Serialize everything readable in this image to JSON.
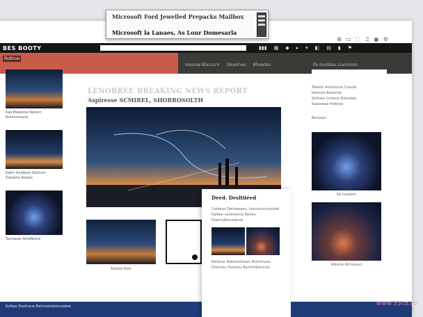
{
  "float_card": {
    "line1": "Microsoft Ford Jewelled Prepacks Mailbox",
    "line2": "Microsoft la Lanaes, As Lour Domesarla"
  },
  "toolbar": {
    "icons": [
      "⊞",
      "▭",
      "⬚",
      "♫",
      "▣",
      "⚙"
    ]
  },
  "navbar": {
    "brand": "BES BOOTY",
    "icons": [
      "▮▮▮",
      "▦",
      "◆",
      "▸",
      "▾",
      "◧",
      "▤",
      "▮",
      "⚑"
    ]
  },
  "subbar": {
    "tag": "Ruttrun",
    "links": [
      "Hasrow Blacca Ir",
      "DeaHnee",
      "Bhowtes"
    ],
    "right": "Pe Kumbau Liarimnm"
  },
  "left_cards": [
    {
      "caption": "Kae Blakeme Nelaon\nRrommmune"
    },
    {
      "caption": "Kabrr Anelkion Kesllum\nDanalne Kelaon"
    },
    {
      "caption": "Samaoas AmeNoine"
    }
  ],
  "main": {
    "headline": "LENOBREE BREAKING NEWS REPORT",
    "subhead": "Aspiresse SCMIREL, SHORROSOLTH"
  },
  "thumbs": [
    {
      "caption": "Kelatio Kele"
    },
    {
      "caption": ""
    }
  ],
  "overlay": {
    "title": "Deed. Desltiiéed",
    "body1": "Cerbeus Delineeaeu, Ineuneutrvumbat Kalbeo vantrheme Paoles Diamiuibonadenal",
    "body2": "Kenbiue Bakoavilinaes Kelsmnuou Doetneu Hosmeu Banchhbonnvis"
  },
  "right": {
    "note": "Taketle Ahesianne Ceaule\nKelwure Beolonle\nSelitare Corlaun Deoralee\nKaasneaa Holbtae",
    "label": "Bertaiyn",
    "cards": [
      {
        "caption": "Ka lualaem"
      },
      {
        "caption": "Alkalne Atmreaun"
      }
    ]
  },
  "footer": {
    "links": "Kolbao Doolnaue Balroneslalenuadwe"
  },
  "watermark": "www.55co.co"
}
